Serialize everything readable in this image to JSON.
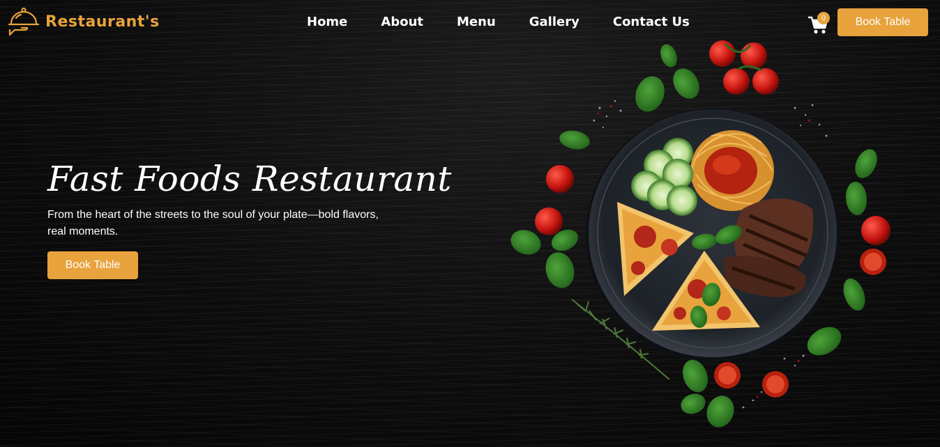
{
  "brand": {
    "name": "Restaurant's",
    "icon": "serving-cloche-icon"
  },
  "nav": {
    "links": [
      {
        "label": "Home"
      },
      {
        "label": "About"
      },
      {
        "label": "Menu"
      },
      {
        "label": "Gallery"
      },
      {
        "label": "Contact Us"
      }
    ],
    "cart": {
      "icon": "cart-icon",
      "count": "0"
    },
    "book_label": "Book Table"
  },
  "hero": {
    "title": "Fast Foods Restaurant",
    "subtitle": "From the heart of the streets to the soul of your plate—bold flavors, real moments.",
    "book_label": "Book Table"
  },
  "colors": {
    "accent": "#e8a33d",
    "background": "#0b0b0b",
    "text": "#ffffff"
  }
}
